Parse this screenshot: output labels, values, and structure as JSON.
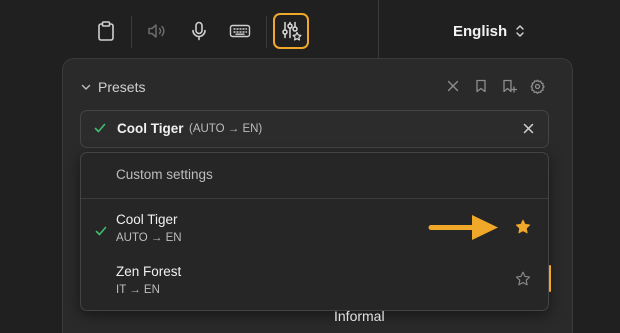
{
  "toolbar": {
    "buttons": [
      {
        "name": "clipboard-button",
        "icon": "clipboard-icon"
      },
      {
        "name": "speaker-button",
        "icon": "speaker-icon"
      },
      {
        "name": "microphone-button",
        "icon": "microphone-icon"
      },
      {
        "name": "keyboard-button",
        "icon": "keyboard-icon"
      },
      {
        "name": "presets-button",
        "icon": "sliders-star-icon",
        "active": true
      }
    ],
    "accent_color": "#f0a82a"
  },
  "language": {
    "selected": "English",
    "icon": "chevron-up-down-icon"
  },
  "presets": {
    "header_label": "Presets",
    "icons": [
      "close-icon",
      "bookmark-icon",
      "bookmark-add-icon",
      "settings-icon"
    ],
    "selected": {
      "name": "Cool Tiger",
      "languages": "(AUTO → EN)"
    },
    "dropdown": {
      "custom_label": "Custom settings",
      "items": [
        {
          "name": "Cool Tiger",
          "languages": "AUTO → EN",
          "selected": true,
          "favorite": true
        },
        {
          "name": "Zen Forest",
          "languages": "IT → EN",
          "selected": false,
          "favorite": false
        }
      ]
    }
  },
  "below_panel_text": "Informal"
}
